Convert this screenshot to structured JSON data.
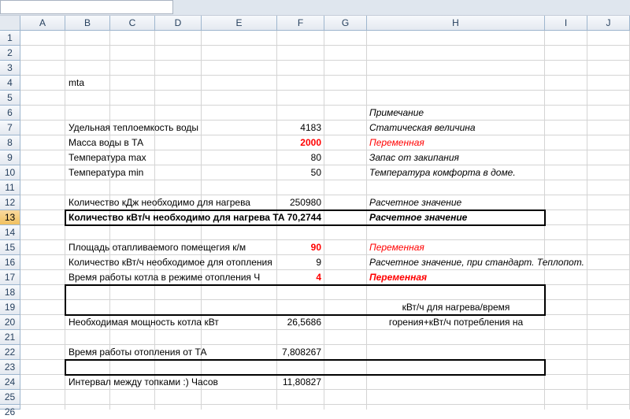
{
  "columns": [
    "A",
    "B",
    "C",
    "D",
    "E",
    "F",
    "G",
    "H",
    "I",
    "J"
  ],
  "rows": [
    "1",
    "2",
    "3",
    "4",
    "5",
    "6",
    "7",
    "8",
    "9",
    "10",
    "11",
    "12",
    "13",
    "14",
    "15",
    "16",
    "17",
    "18",
    "19",
    "20",
    "21",
    "22",
    "23",
    "24",
    "25",
    "26"
  ],
  "cells": {
    "b4": "mta",
    "h6": "Примечание",
    "b7": "Удельная теплоемкость воды",
    "f7": "4183",
    "h7": "Статическая величина",
    "b8": "Масса воды в ТА",
    "f8": "2000",
    "h8": "Переменная",
    "b9": "Температура max",
    "f9": "80",
    "h9": "Запас от закипания",
    "b10": "Температура min",
    "f10": "50",
    "h10": "Температура комфорта в доме.",
    "b12": "Количество кДж необходимо для нагрева",
    "f12": "250980",
    "h12": "Расчетное значение",
    "b13": "Количество кВт/ч необходимо для нагрева ТА",
    "f13": "70,2744",
    "h13": "Расчетное значение",
    "b15": "Площадь отапливаемого помещегия к/м",
    "f15": "90",
    "h15": "Переменная",
    "b16": "Количество кВт/ч необходимое для отопления",
    "f16": "9",
    "h16": "Расчетное значение, при стандарт. Теплопот.",
    "b17": "Время работы котла в режиме отопления Ч",
    "f17": "4",
    "h17": "Переменная",
    "h19": "кВт/ч для нагрева/время",
    "b20": "Необходимая мощность котла кВт",
    "f20": "26,5686",
    "h20": "горения+кВт/ч потребления на",
    "b22": "Время работы отопления от ТА",
    "f22": "7,808267",
    "b24": "Интервал между топками :) Часов",
    "f24": "11,80827"
  }
}
